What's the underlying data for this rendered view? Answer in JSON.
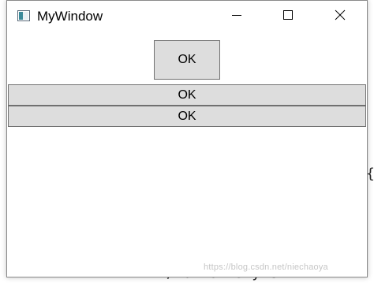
{
  "window": {
    "title": "MyWindow",
    "title_icon": "window-app-icon",
    "caption_buttons": [
      {
        "name": "minimize-icon"
      },
      {
        "name": "maximize-icon"
      },
      {
        "name": "close-icon"
      }
    ]
  },
  "content": {
    "button_center_label": "OK",
    "button_row1_label": "OK",
    "button_row2_label": "OK"
  },
  "background": {
    "code_fragment_bottom": "</Button.Style>",
    "code_fragment_right": "{"
  },
  "watermark": "https://blog.csdn.net/niechaoya",
  "colors": {
    "button_face": "#dddddd",
    "button_border": "#707070",
    "window_border": "#8a8a8a"
  }
}
